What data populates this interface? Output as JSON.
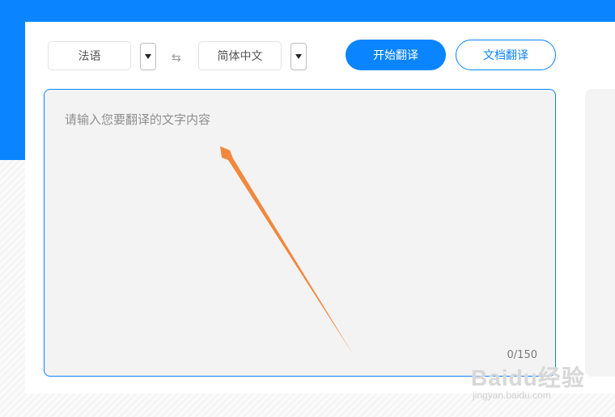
{
  "source_lang": {
    "label": "法语"
  },
  "target_lang": {
    "label": "简体中文"
  },
  "swap_icon": {
    "glyph": "⇆",
    "name": "swap-icon"
  },
  "dropdown_icon": "chevron-down-icon",
  "actions": {
    "start_label": "开始翻译",
    "doc_label": "文档翻译"
  },
  "input": {
    "placeholder": "请输入您要翻译的文字内容",
    "counter": "0/150"
  },
  "watermark": {
    "logo": "Baidu经验",
    "url": "jingyan.baidu.com"
  },
  "colors": {
    "accent": "#0a84ff",
    "annotation_arrow": "#f0883e",
    "input_bg": "#f4f3f3"
  }
}
